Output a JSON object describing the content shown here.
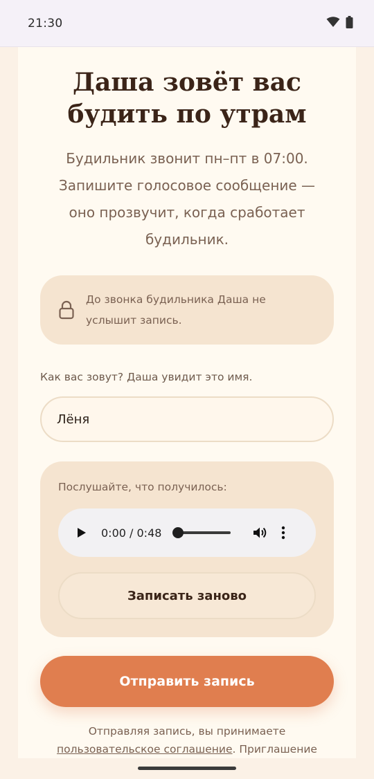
{
  "status_bar": {
    "time": "21:30",
    "icons": [
      "wifi-icon",
      "battery-icon"
    ]
  },
  "page": {
    "title": "Даша зовёт вас будить по утрам",
    "subtitle": "Будильник звонит пн–пт в 07:00. Запишите голосовое сообщение — оно прозвучит, когда сработает будильник."
  },
  "notice": {
    "icon": "lock-icon",
    "text": "До звонка будильника Даша не услышит запись."
  },
  "name_field": {
    "label": "Как вас зовут? Даша увидит это имя.",
    "value": "Лёня"
  },
  "listen": {
    "label": "Послушайте, что получилось:",
    "player": {
      "time": "0:00 / 0:48",
      "progress": 0
    },
    "rerecord_label": "Записать заново"
  },
  "send_label": "Отправить запись",
  "legal": {
    "prefix": "Отправляя запись, вы принимаете",
    "link": "пользовательское соглашение",
    "suffix": ". Приглашение"
  },
  "colors": {
    "accent": "#e07e4f",
    "panel": "#f5e4d0",
    "card": "#fffaf1",
    "background": "#fbf1e6"
  }
}
